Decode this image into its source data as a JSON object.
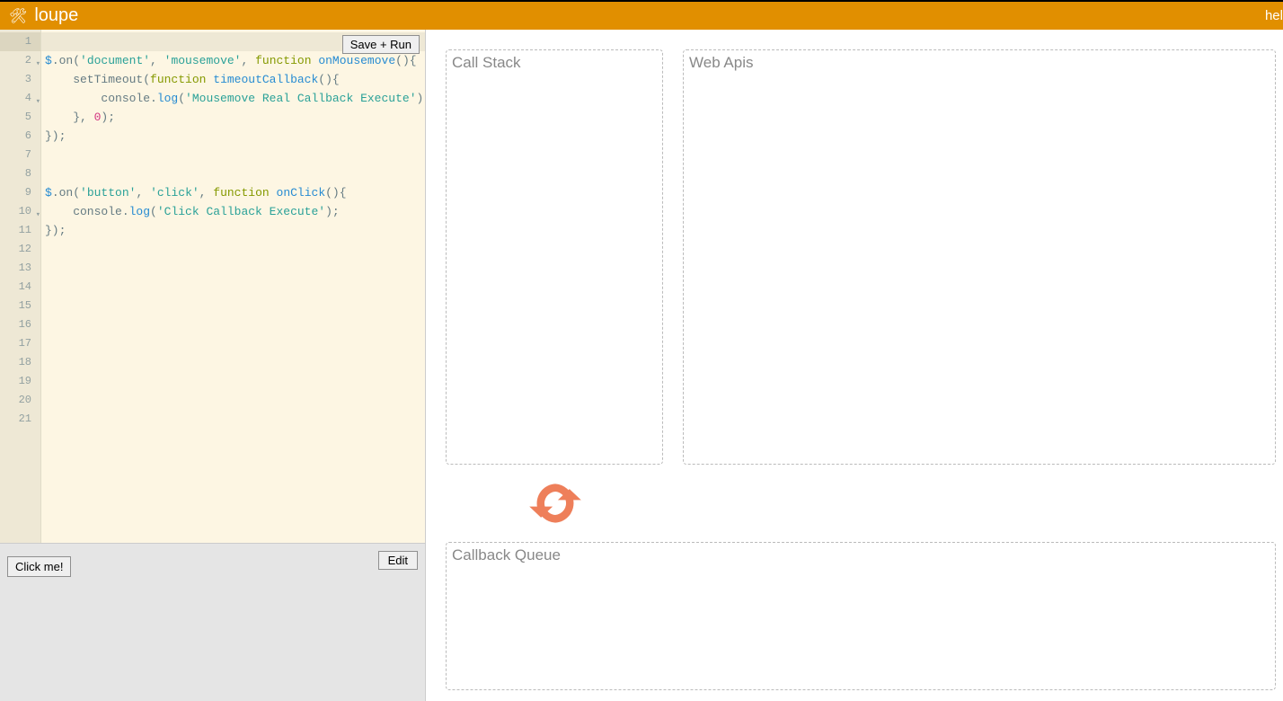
{
  "header": {
    "app_title": "loupe",
    "help_label": "hel"
  },
  "editor": {
    "save_run_label": "Save + Run",
    "line_count": 21,
    "active_line": 1,
    "fold_lines": [
      2,
      4,
      10
    ],
    "code_lines": [
      "",
      "$.on('document', 'mousemove', function onMousemove(){",
      "    setTimeout(function timeoutCallback(){",
      "        console.log('Mousemove Real Callback Execute');",
      "    }, 0);",
      "});",
      "",
      "",
      "$.on('button', 'click', function onClick(){",
      "    console.log('Click Callback Execute');",
      "});",
      "",
      "",
      "",
      "",
      "",
      "",
      "",
      "",
      "",
      ""
    ]
  },
  "render": {
    "click_me_label": "Click me!",
    "edit_label": "Edit"
  },
  "panels": {
    "call_stack_label": "Call Stack",
    "web_apis_label": "Web Apis",
    "callback_queue_label": "Callback Queue"
  },
  "colors": {
    "header_bg": "#e18f00",
    "loop_icon": "#ee7f5a"
  }
}
